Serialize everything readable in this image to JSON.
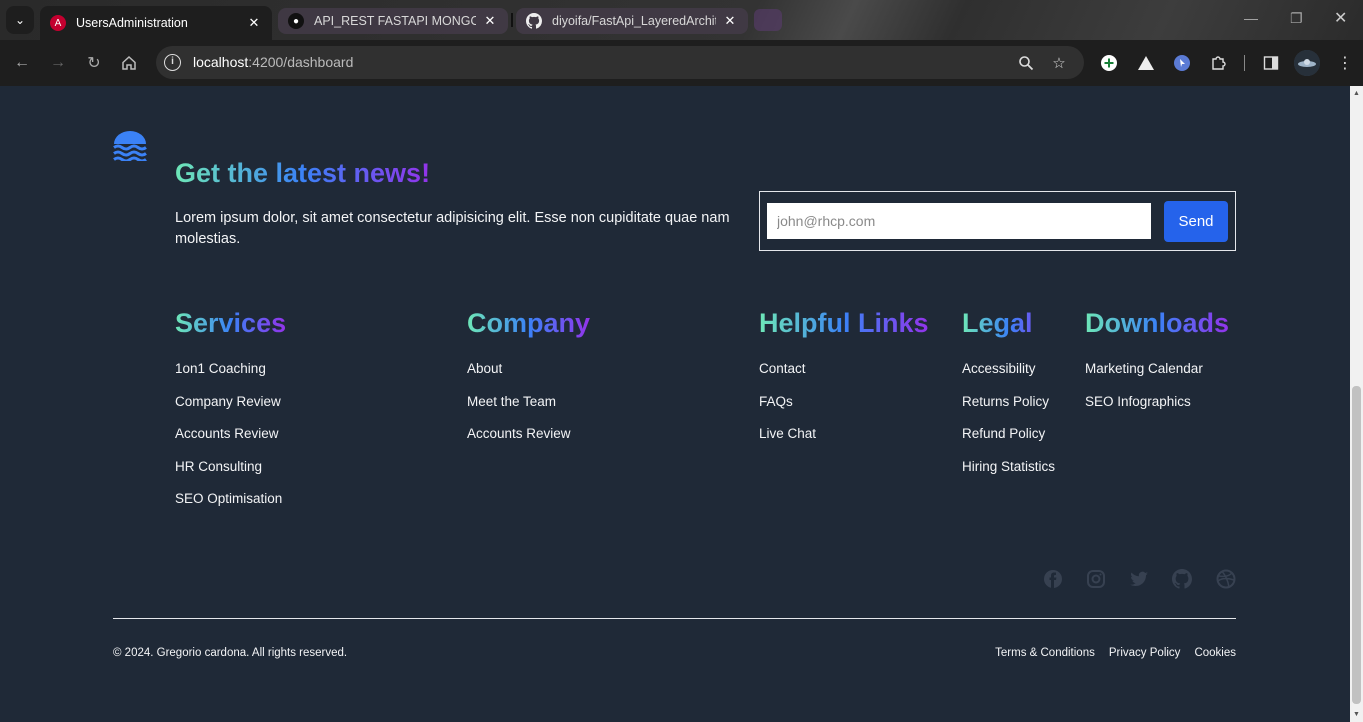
{
  "browser": {
    "tabs": [
      {
        "title": "UsersAdministration",
        "active": true,
        "icon": "angular-icon"
      },
      {
        "title": "API_REST FASTAPI MONGODB J",
        "active": false,
        "icon": "notion-icon"
      },
      {
        "title": "diyoifa/FastApi_LayeredArchitec",
        "active": false,
        "icon": "github-icon"
      }
    ],
    "url_host": "localhost",
    "url_path": ":4200/dashboard"
  },
  "newsletter": {
    "title": "Get the latest news!",
    "text": "Lorem ipsum dolor, sit amet consectetur adipisicing elit. Esse non cupiditate quae nam molestias.",
    "email_placeholder": "john@rhcp.com",
    "send_label": "Send"
  },
  "columns": [
    {
      "heading": "Services",
      "links": [
        "1on1 Coaching",
        "Company Review",
        "Accounts Review",
        "HR Consulting",
        "SEO Optimisation"
      ]
    },
    {
      "heading": "Company",
      "links": [
        "About",
        "Meet the Team",
        "Accounts Review"
      ]
    },
    {
      "heading": "Helpful Links",
      "links": [
        "Contact",
        "FAQs",
        "Live Chat"
      ]
    },
    {
      "heading": "Legal",
      "links": [
        "Accessibility",
        "Returns Policy",
        "Refund Policy",
        "Hiring Statistics"
      ]
    },
    {
      "heading": "Downloads",
      "links": [
        "Marketing Calendar",
        "SEO Infographics"
      ]
    }
  ],
  "socials": [
    "facebook-icon",
    "instagram-icon",
    "twitter-icon",
    "github-icon",
    "dribbble-icon"
  ],
  "bottom": {
    "copyright": "© 2024. Gregorio cardona. All rights reserved.",
    "links": [
      "Terms & Conditions",
      "Privacy Policy",
      "Cookies"
    ]
  },
  "colors": {
    "footer_bg": "#1f2937",
    "accent_blue": "#2563eb",
    "gradient": [
      "#6ee7b7",
      "#3b82f6",
      "#9333ea"
    ]
  }
}
